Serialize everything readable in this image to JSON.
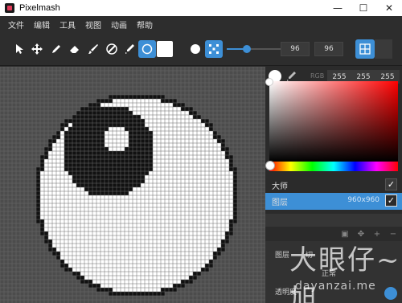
{
  "window": {
    "title": "Pixelmash",
    "minimize": "—",
    "maximize": "☐",
    "close": "✕"
  },
  "menu": {
    "items": [
      "文件",
      "编辑",
      "工具",
      "视图",
      "动画",
      "帮助"
    ]
  },
  "toolbar": {
    "tools": [
      "pointer-icon",
      "move-icon",
      "pencil-icon",
      "eraser-icon",
      "brush-icon",
      "fill-icon",
      "eyedropper-icon",
      "ellipse-icon"
    ],
    "active_tool": "ellipse-icon",
    "brush_width": "96",
    "brush_height": "96",
    "size_slider_fraction": 0.35
  },
  "color": {
    "label": "RGB",
    "r": "255",
    "g": "255",
    "b": "255",
    "accent": "#3d8fd6"
  },
  "layers": {
    "rows": [
      {
        "name": "大师",
        "checked": "✓"
      },
      {
        "name": "图层",
        "size": "960x960",
        "checked": "✓"
      }
    ]
  },
  "properties": {
    "layer_label": "图层",
    "tab_label": "切",
    "blend_label": "正常",
    "opacity_label": "透明度"
  },
  "watermark": {
    "main": "大眼仔~旭",
    "sub": "dayanzai.me"
  }
}
